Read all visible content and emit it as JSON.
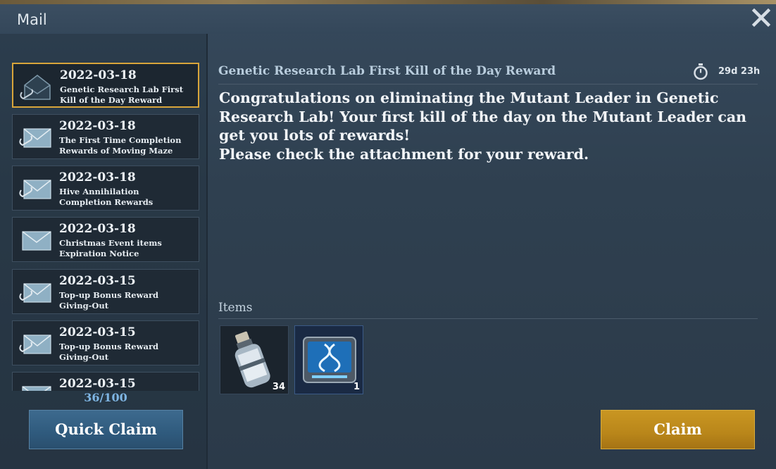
{
  "window": {
    "title": "Mail",
    "close_icon": "close-icon"
  },
  "mail_list": {
    "items": [
      {
        "date": "2022-03-18",
        "subject": "Genetic Research Lab First Kill of the Day Reward",
        "icon": "opened-mail-attachment-icon",
        "selected": true
      },
      {
        "date": "2022-03-18",
        "subject": "The First Time Completion Rewards of Moving Maze",
        "icon": "mail-attachment-icon",
        "selected": false
      },
      {
        "date": "2022-03-18",
        "subject": "Hive Annihilation Completion Rewards",
        "icon": "mail-attachment-icon",
        "selected": false
      },
      {
        "date": "2022-03-18",
        "subject": "Christmas Event items Expiration Notice",
        "icon": "mail-icon",
        "selected": false
      },
      {
        "date": "2022-03-15",
        "subject": "Top-up Bonus Reward Giving-Out",
        "icon": "mail-attachment-icon",
        "selected": false
      },
      {
        "date": "2022-03-15",
        "subject": "Top-up Bonus Reward Giving-Out",
        "icon": "mail-attachment-icon",
        "selected": false
      },
      {
        "date": "2022-03-15",
        "subject": "",
        "icon": "mail-icon",
        "selected": false
      }
    ],
    "count": "36/100"
  },
  "buttons": {
    "quick_claim": "Quick Claim",
    "claim": "Claim"
  },
  "detail": {
    "subject": "Genetic Research Lab First Kill of the Day Reward",
    "timer_icon": "stopwatch-icon",
    "time_left": "29d 23h",
    "body_paragraphs": [
      "Congratulations on eliminating the Mutant Leader in Genetic Research Lab! Your first kill of the day on the Mutant Leader can get you lots of rewards!",
      "Please check the attachment for your reward."
    ],
    "items_label": "Items",
    "items": [
      {
        "icon": "canister-item-icon",
        "quantity": "34"
      },
      {
        "icon": "dna-tablet-item-icon",
        "quantity": "1"
      }
    ]
  },
  "colors": {
    "selected_border": "#d9a53a",
    "claim_button": "#b9861a",
    "quick_claim_button": "#2f5a7d",
    "count_text": "#7fb6e4"
  }
}
